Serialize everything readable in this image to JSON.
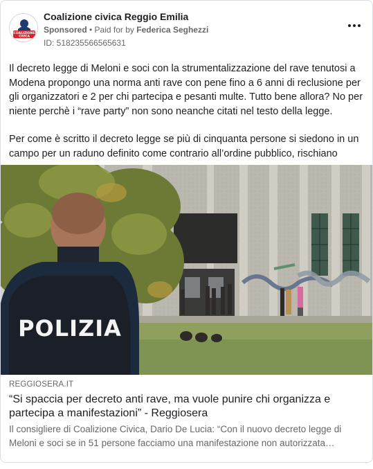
{
  "post": {
    "page_name": "Coalizione civica Reggio Emilia",
    "avatar_text_line1": "COALIZIONE",
    "avatar_text_line2": "CIVICA",
    "sponsored_label": "Sponsored",
    "separator": " • ",
    "paid_for_label": "Paid for by ",
    "payer": "Federica Seghezzi",
    "ad_id": "ID: 518235566565631",
    "more_icon": "more-horizontal-icon",
    "body_paragraph_1": "Il decreto legge di Meloni e soci con la strumentalizzazione del rave tenutosi a Modena propongo una norma anti rave con pene fino a 6 anni di reclusione per gli organizzatori e 2 per chi partecipa e pesanti multe. Tutto bene allora? No per niente perchè i “rave party” non sono neanche citati nel testo della legge.",
    "body_paragraph_2": "Per come è scritto il decreto legge se più di cinquanta persone si siedono in un campo per un raduno definito come contrario all’ordine pubblico, rischiano una…"
  },
  "image": {
    "uniform_text": "POLIZIA"
  },
  "link": {
    "domain": "REGGIOSERA.IT",
    "title": "“Si spaccia per decreto anti rave, ma vuole punire chi organizza e partecipa a manifestazioni” - Reggiosera",
    "description": "Il consigliere di Coalizione Civica, Dario De Lucia: “Con il nuovo decreto legge di Meloni e soci se in 51 persone facciamo una manifestazione non autorizzata…"
  },
  "colors": {
    "brand_red": "#d8232a",
    "brand_navy": "#1f3b73",
    "meta_gray": "#65676b"
  }
}
